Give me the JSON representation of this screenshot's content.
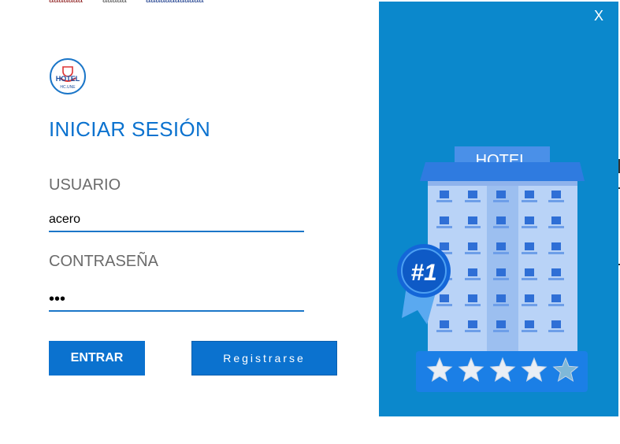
{
  "login": {
    "title": "INICIAR SESIÓN",
    "username_label": "USUARIO",
    "username_value": "acero",
    "password_label": "CONTRASEÑA",
    "password_value": "•••",
    "enter_label": "ENTRAR",
    "register_label": "Registrarse"
  },
  "logo": {
    "text": "HOTEL",
    "subtext": "HC.UNE"
  },
  "panel": {
    "close_label": "X",
    "sign_text": "HOTEL",
    "ribbon_text": "#1",
    "stars": 4.5,
    "colors": {
      "background": "#0b88cc",
      "accent": "#0b72cf"
    }
  }
}
